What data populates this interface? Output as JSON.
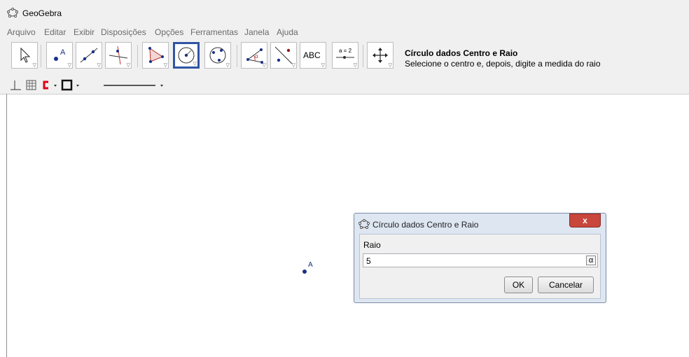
{
  "window": {
    "title": "GeoGebra"
  },
  "menu": [
    "Arquivo",
    "Editar",
    "Exibir",
    "Disposições",
    "Opções",
    "Ferramentas",
    "Janela",
    "Ajuda"
  ],
  "toolbar": {
    "text_tool_label": "ABC",
    "slider_tool_label": "a = 2",
    "selected_tool_name": "Círculo dados Centro e Raio",
    "selected_tool_desc": "Selecione o centro e, depois, digite a medida do raio"
  },
  "canvas": {
    "point_label": "A"
  },
  "dialog": {
    "title": "Círculo dados Centro e Raio",
    "close_glyph": "x",
    "field_label": "Raio",
    "field_value": "5",
    "alpha_glyph": "α",
    "ok_label": "OK",
    "cancel_label": "Cancelar"
  },
  "colors": {
    "selection_border": "#2f55a4",
    "point": "#1a3088",
    "close_button": "#c9463d"
  }
}
